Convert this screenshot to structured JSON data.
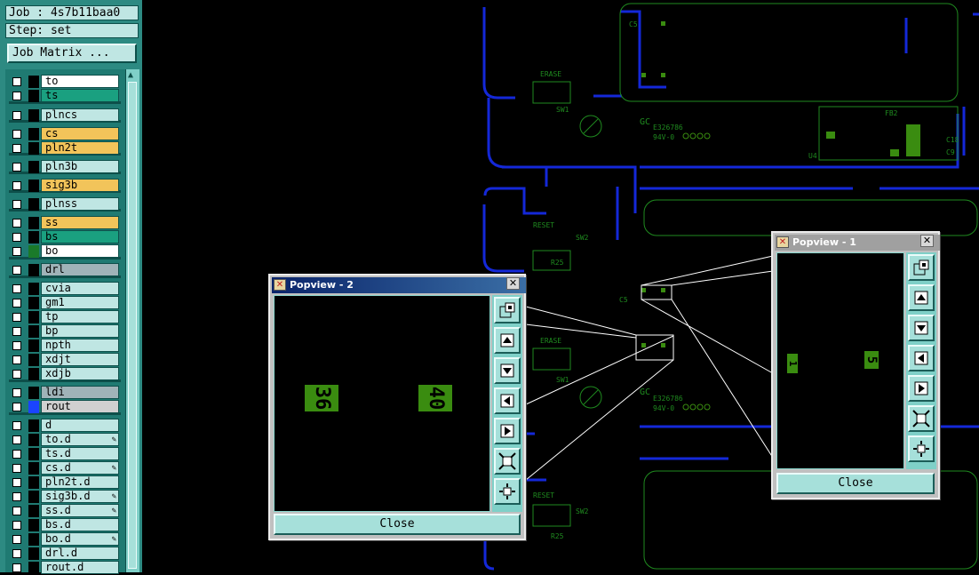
{
  "sidebar": {
    "job_label": "Job : 4s7b11baa0",
    "step_label": "Step: set",
    "job_matrix_button": "Job Matrix ...",
    "layers": [
      {
        "name": "to",
        "color": "#ffffff"
      },
      {
        "name": "ts",
        "color": "#1aa080"
      },
      {
        "name": "plncs",
        "color": "#bfe6e3"
      },
      {
        "name": "cs",
        "color": "#f2c45a"
      },
      {
        "name": "pln2t",
        "color": "#f2c45a"
      },
      {
        "name": "pln3b",
        "color": "#bfe6e3"
      },
      {
        "name": "sig3b",
        "color": "#f2c45a"
      },
      {
        "name": "plnss",
        "color": "#bfe6e3"
      },
      {
        "name": "ss",
        "color": "#f2c45a"
      },
      {
        "name": "bs",
        "color": "#1aa080"
      },
      {
        "name": "bo",
        "color": "#ffffff",
        "active": true
      },
      {
        "name": "drl",
        "color": "#9fb3b8"
      },
      {
        "name": "cvia",
        "color": "#bfe6e3"
      },
      {
        "name": "gm1",
        "color": "#bfe6e3"
      },
      {
        "name": "tp",
        "color": "#bfe6e3"
      },
      {
        "name": "bp",
        "color": "#bfe6e3"
      },
      {
        "name": "npth",
        "color": "#bfe6e3"
      },
      {
        "name": "xdjt",
        "color": "#bfe6e3"
      },
      {
        "name": "xdjb",
        "color": "#bfe6e3"
      },
      {
        "name": "ldi",
        "color": "#9fb3b8"
      },
      {
        "name": "rout",
        "color": "#d0d0d0",
        "indicator": "#1a44ff"
      },
      {
        "name": "d",
        "color": "#bfe6e3"
      },
      {
        "name": "to.d",
        "color": "#bfe6e3",
        "mark": true
      },
      {
        "name": "ts.d",
        "color": "#bfe6e3"
      },
      {
        "name": "cs.d",
        "color": "#bfe6e3",
        "mark": true
      },
      {
        "name": "pln2t.d",
        "color": "#bfe6e3"
      },
      {
        "name": "sig3b.d",
        "color": "#bfe6e3",
        "mark": true
      },
      {
        "name": "ss.d",
        "color": "#bfe6e3",
        "mark": true
      },
      {
        "name": "bs.d",
        "color": "#bfe6e3"
      },
      {
        "name": "bo.d",
        "color": "#bfe6e3",
        "mark": true
      },
      {
        "name": "drl.d",
        "color": "#bfe6e3"
      },
      {
        "name": "rout.d",
        "color": "#bfe6e3"
      }
    ]
  },
  "board_labels": {
    "erase": "ERASE",
    "reset": "RESET",
    "sw1": "SW1",
    "sw2": "SW2",
    "r25": "R25",
    "u4": "U4",
    "fb2": "FB2",
    "c18": "C18",
    "c9": "C9",
    "c5": "C5",
    "gc": "GC",
    "cs_code": "E326786",
    "cs_code2": "94V-0"
  },
  "popview2": {
    "title": "Popview - 2",
    "close_label": "Close",
    "text_a": "36",
    "text_b": "40"
  },
  "popview1": {
    "title": "Popview - 1",
    "close_label": "Close",
    "text_a": "1",
    "text_b": "5"
  },
  "tool_icons": [
    "zoom-fit-icon",
    "pan-up-icon",
    "pan-down-icon",
    "pan-left-icon",
    "pan-right-icon",
    "zoom-in-icon",
    "zoom-out-icon"
  ],
  "colors": {
    "panel": "#2d8a82",
    "pcb_trace": "#1428d8",
    "pcb_outline": "#1f8a1f",
    "pad": "#3a8c10"
  }
}
